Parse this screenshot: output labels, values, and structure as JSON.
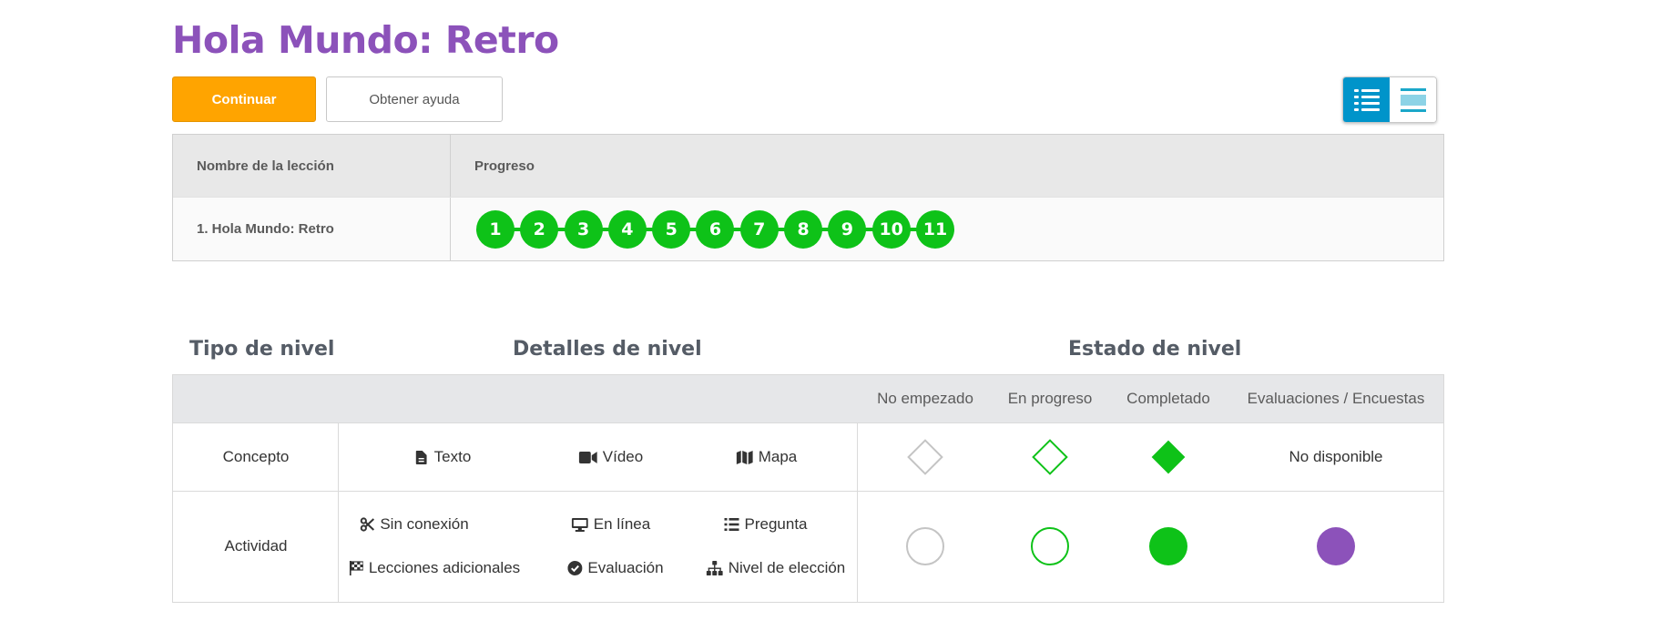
{
  "page_title": "Hola Mundo: Retro",
  "buttons": {
    "continue": "Continuar",
    "help": "Obtener ayuda"
  },
  "view_toggle": {
    "active": "list-detail-view",
    "icons": [
      "list-detail-icon",
      "list-compact-icon"
    ]
  },
  "progress_table": {
    "headers": [
      "Nombre de la lección",
      "Progreso"
    ],
    "rows": [
      {
        "lesson": "1. Hola Mundo: Retro",
        "levels": [
          "1",
          "2",
          "3",
          "4",
          "5",
          "6",
          "7",
          "8",
          "9",
          "10",
          "11"
        ],
        "status": "completado"
      }
    ]
  },
  "key": {
    "headings": {
      "type": "Tipo de nivel",
      "details": "Detalles de nivel",
      "status": "Estado de nivel"
    },
    "status_columns": [
      "No empezado",
      "En progreso",
      "Completado",
      "Evaluaciones / Encuestas"
    ],
    "concept": {
      "label": "Concepto",
      "details": [
        "Texto",
        "Vídeo",
        "Mapa"
      ],
      "assessment_text": "No disponible"
    },
    "activity": {
      "label": "Actividad",
      "details": [
        "Sin conexión",
        "En línea",
        "Pregunta",
        "Lecciones adicionales",
        "Evaluación",
        "Nivel de elección"
      ]
    }
  },
  "colors": {
    "brand_purple": "#8c52ba",
    "continue_orange": "#ffa400",
    "complete_green": "#0ec218",
    "toggle_blue": "#0094ca",
    "not_started_gray": "#c4c4c4"
  }
}
